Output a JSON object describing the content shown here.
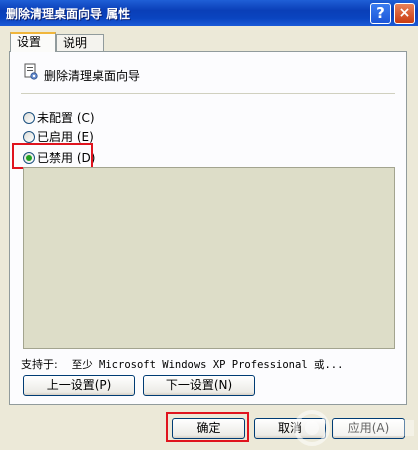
{
  "window": {
    "title": "删除清理桌面向导 属性",
    "help_icon": "?",
    "close_icon": "×"
  },
  "tabs": [
    {
      "label": "设置"
    },
    {
      "label": "说明"
    }
  ],
  "policy": {
    "name": "删除清理桌面向导"
  },
  "options": [
    {
      "label": "未配置 (C)",
      "checked": false
    },
    {
      "label": "已启用 (E)",
      "checked": false
    },
    {
      "label": "已禁用 (D)",
      "checked": true
    }
  ],
  "supported": {
    "label": "支持于:",
    "value": "至少 Microsoft Windows XP Professional 或..."
  },
  "buttons": {
    "prev": "上一设置(P)",
    "next": "下一设置(N)",
    "ok": "确定",
    "cancel": "取消",
    "apply": "应用(A)"
  },
  "colors": {
    "highlight": "#e0141e",
    "titlebar": "#0a44c0"
  }
}
